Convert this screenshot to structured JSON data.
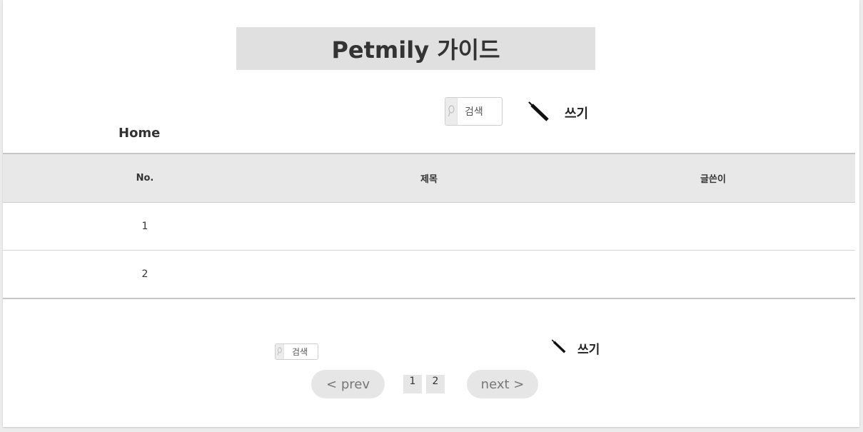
{
  "header": {
    "title": "Petmily 가이드"
  },
  "toolbar_top": {
    "search_label": "검색",
    "write_label": "쓰기"
  },
  "nav": {
    "home_label": "Home"
  },
  "table": {
    "columns": [
      "No.",
      "제목",
      "글쓴이"
    ],
    "rows": [
      {
        "no": "1",
        "title": "",
        "author": ""
      },
      {
        "no": "2",
        "title": "",
        "author": ""
      }
    ]
  },
  "toolbar_bottom": {
    "search_label": "검색",
    "write_label": "쓰기"
  },
  "pagination": {
    "prev_label": "< prev",
    "pages": [
      "1",
      "2"
    ],
    "next_label": "next >"
  },
  "icons": {
    "search": "magnifier-icon",
    "write": "pen-icon"
  },
  "colors": {
    "title_bg": "#e0e0e0",
    "header_bg": "#e8e8e8",
    "button_bg": "#e6e6e6"
  }
}
